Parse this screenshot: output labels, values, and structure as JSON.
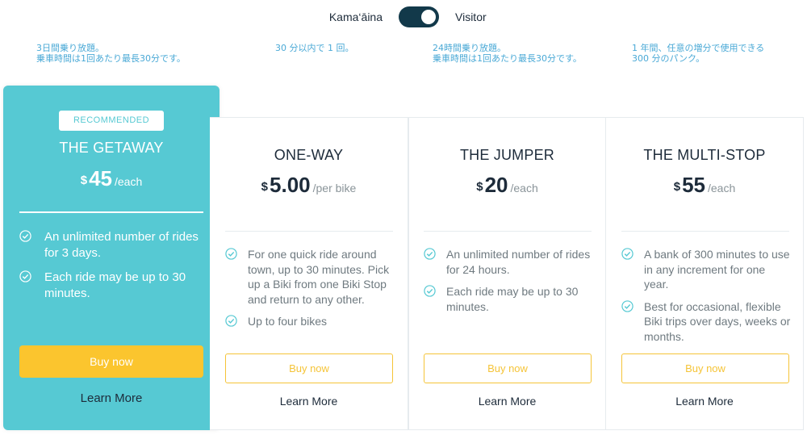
{
  "toggle": {
    "left_label": "Kama‘āina",
    "right_label": "Visitor",
    "selected": "Visitor"
  },
  "notes": [
    {
      "line1": "3日間乗り放題。",
      "line2": "乗車時間は1回あたり最長30分です。"
    },
    {
      "line1": "30 分以内で 1 回。",
      "line2": ""
    },
    {
      "line1": "24時間乗り放題。",
      "line2": "乗車時間は1回あたり最長30分です。"
    },
    {
      "line1": "1 年間、任意の増分で使用できる",
      "line2": "300 分のパンク。"
    }
  ],
  "plans": [
    {
      "badge": "RECOMMENDED",
      "title": "THE GETAWAY",
      "currency": "$",
      "amount": "45",
      "per": "/each",
      "features": [
        "An unlimited number of rides for 3 days.",
        "Each ride may be up to 30 minutes."
      ],
      "buy_label": "Buy now",
      "learn_label": "Learn More"
    },
    {
      "title": "ONE-WAY",
      "currency": "$",
      "amount": "5.00",
      "per": "/per bike",
      "features": [
        "For one quick ride around town, up to 30 minutes. Pick up a Biki from one Biki Stop and return to any other.",
        "Up to four bikes"
      ],
      "buy_label": "Buy now",
      "learn_label": "Learn More"
    },
    {
      "title": "THE JUMPER",
      "currency": "$",
      "amount": "20",
      "per": "/each",
      "features": [
        "An unlimited number of rides for 24 hours.",
        "Each ride may be up to 30 minutes."
      ],
      "buy_label": "Buy now",
      "learn_label": "Learn More"
    },
    {
      "title": "THE MULTI-STOP",
      "currency": "$",
      "amount": "55",
      "per": "/each",
      "features": [
        "A bank of 300 minutes to use in any increment for one year.",
        "Best for occasional, flexible Biki trips over days, weeks or months."
      ],
      "buy_label": "Buy now",
      "learn_label": "Learn More"
    }
  ],
  "colors": {
    "teal": "#56c9d3",
    "navy": "#12394a",
    "yellow": "#fbc52e",
    "note_blue": "#4aa9d6"
  },
  "icons": {
    "feature_bullet": "check-circle-icon"
  }
}
